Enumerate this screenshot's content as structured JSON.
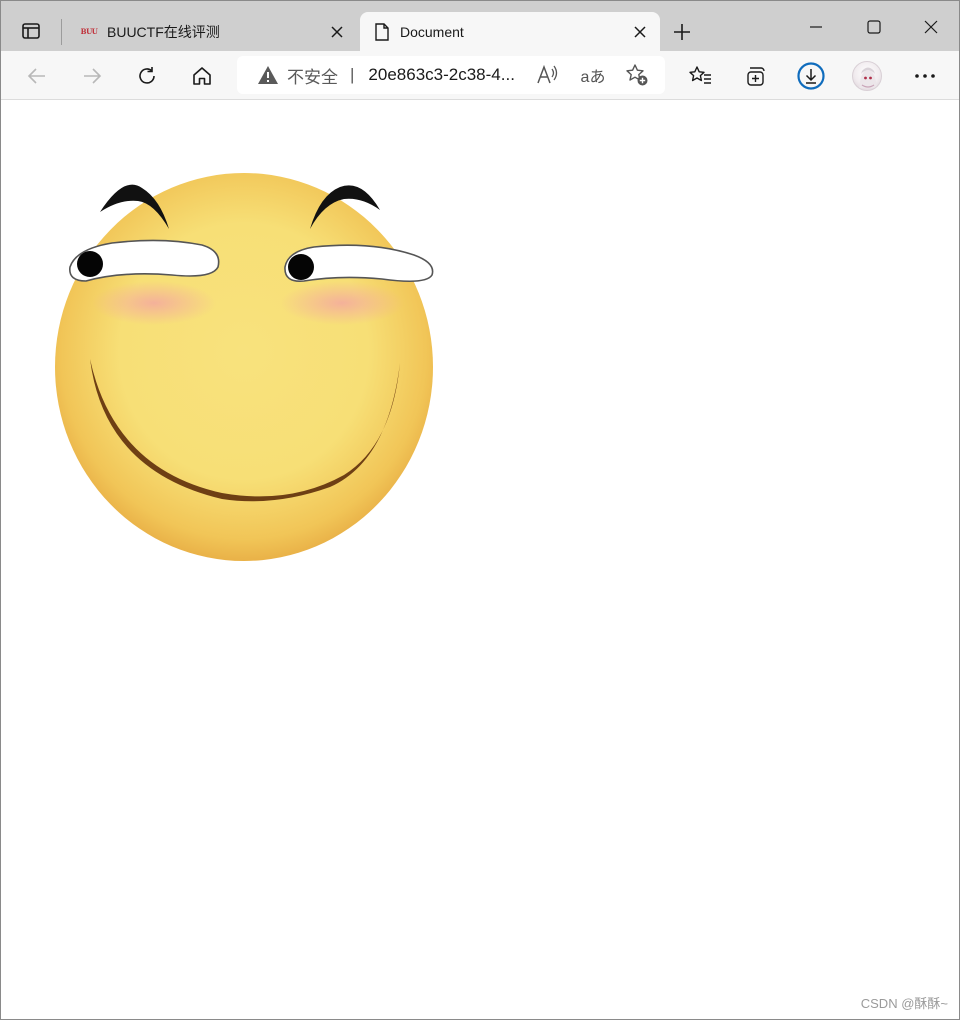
{
  "browser": {
    "tabs": [
      {
        "title": "BUUCTF在线评测",
        "favicon": "buuctf-logo-icon",
        "favicon_text": "BUU",
        "active": false
      },
      {
        "title": "Document",
        "favicon": "page-icon",
        "active": true
      }
    ],
    "address_bar": {
      "security_label": "不安全",
      "separator": "|",
      "url": "20e863c3-2c38-4..."
    },
    "icons": {
      "back": "back-arrow-icon",
      "forward": "forward-arrow-icon",
      "refresh": "refresh-icon",
      "home": "home-icon",
      "read_aloud": "read-aloud-icon",
      "translate": "translate-icon",
      "favorites_add": "add-favorite-icon",
      "favorites": "favorites-icon",
      "collections": "collections-icon",
      "downloads": "download-icon",
      "profile": "profile-avatar",
      "menu": "more-menu-icon"
    },
    "translate_glyph": "aあ",
    "colors": {
      "tabstrip": "#cfcfcf",
      "toolbar": "#f7f7f7",
      "download_accent": "#0f6cbd"
    }
  },
  "page": {
    "image": "smirking-smiley-face",
    "watermark": "CSDN @酥酥~"
  }
}
